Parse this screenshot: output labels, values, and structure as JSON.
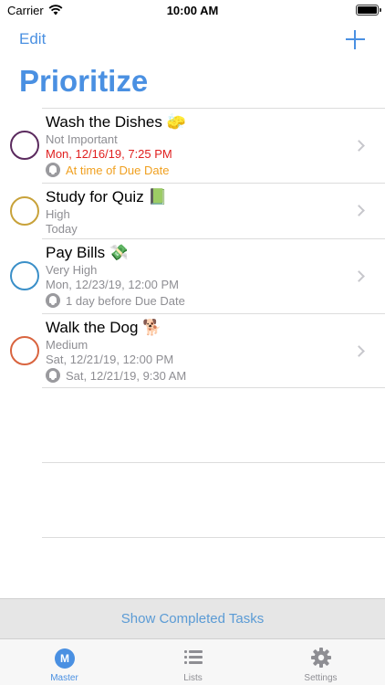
{
  "status_bar": {
    "carrier": "Carrier",
    "time": "10:00 AM"
  },
  "nav": {
    "edit_label": "Edit",
    "add_icon": "plus-icon",
    "title": "Prioritize"
  },
  "tasks": [
    {
      "title": "Wash the Dishes 🧽",
      "priority": "Not Important",
      "due": "Mon, 12/16/19, 7:25 PM",
      "reminder": "At time of Due Date",
      "circle_color": "#5b2a5e"
    },
    {
      "title": "Study for Quiz 📗",
      "priority": "High",
      "due": "Today",
      "reminder": "",
      "circle_color": "#c8a23a"
    },
    {
      "title": "Pay Bills 💸",
      "priority": "Very High",
      "due": "Mon, 12/23/19, 12:00 PM",
      "reminder": "1 day before Due Date",
      "circle_color": "#3a8fc8"
    },
    {
      "title": "Walk the Dog 🐕",
      "priority": "Medium",
      "due": "Sat, 12/21/19, 12:00 PM",
      "reminder": "Sat, 12/21/19, 9:30 AM",
      "circle_color": "#d9643f"
    }
  ],
  "completed": {
    "label": "Show Completed Tasks"
  },
  "tabs": [
    {
      "label": "Master",
      "icon": "master-icon",
      "active": true
    },
    {
      "label": "Lists",
      "icon": "lists-icon",
      "active": false
    },
    {
      "label": "Settings",
      "icon": "settings-icon",
      "active": false
    }
  ],
  "colors": {
    "accent": "#4a90e2",
    "overdue": "#e02020",
    "reminder_due": "#f0a020"
  }
}
